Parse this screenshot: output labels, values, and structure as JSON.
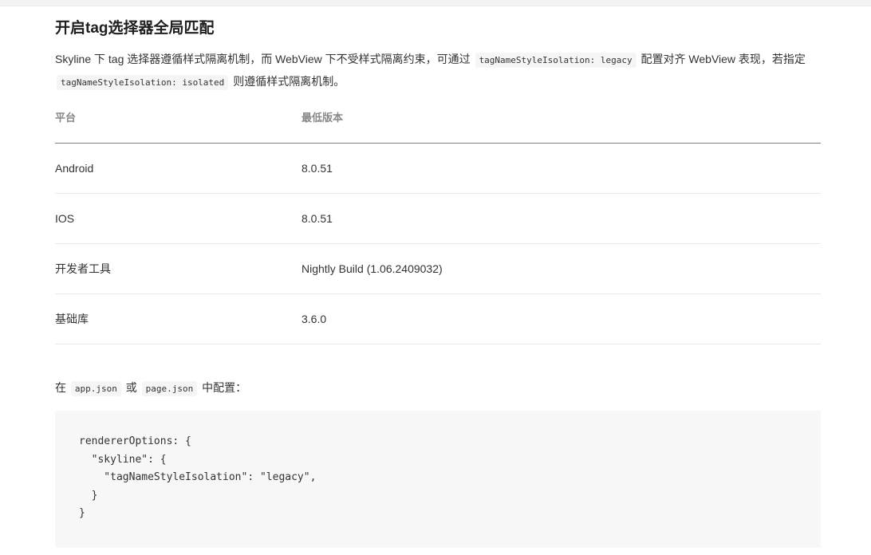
{
  "section": {
    "title": "开启tag选择器全局匹配"
  },
  "description": {
    "part1": "Skyline 下 tag 选择器遵循样式隔离机制，而 WebView 下不受样式隔离约束，可通过",
    "code1": "tagNameStyleIsolation: legacy",
    "part2": "配置对齐 WebView 表现，若指定",
    "code2": "tagNameStyleIsolation: isolated",
    "part3": "则遵循样式隔离机制。"
  },
  "table": {
    "headers": {
      "platform": "平台",
      "min_version": "最低版本"
    },
    "rows": [
      {
        "platform": "Android",
        "version": "8.0.51"
      },
      {
        "platform": "IOS",
        "version": "8.0.51"
      },
      {
        "platform": "开发者工具",
        "version": "Nightly Build (1.06.2409032)"
      },
      {
        "platform": "基础库",
        "version": "3.6.0"
      }
    ]
  },
  "config": {
    "prefix": "在",
    "file1": "app.json",
    "or": "或",
    "file2": "page.json",
    "suffix": "中配置："
  },
  "code_block": {
    "lines": [
      "rendererOptions: {",
      "  \"skyline\": {",
      "    \"tagNameStyleIsolation\": \"legacy\",",
      "  }",
      "}"
    ]
  }
}
